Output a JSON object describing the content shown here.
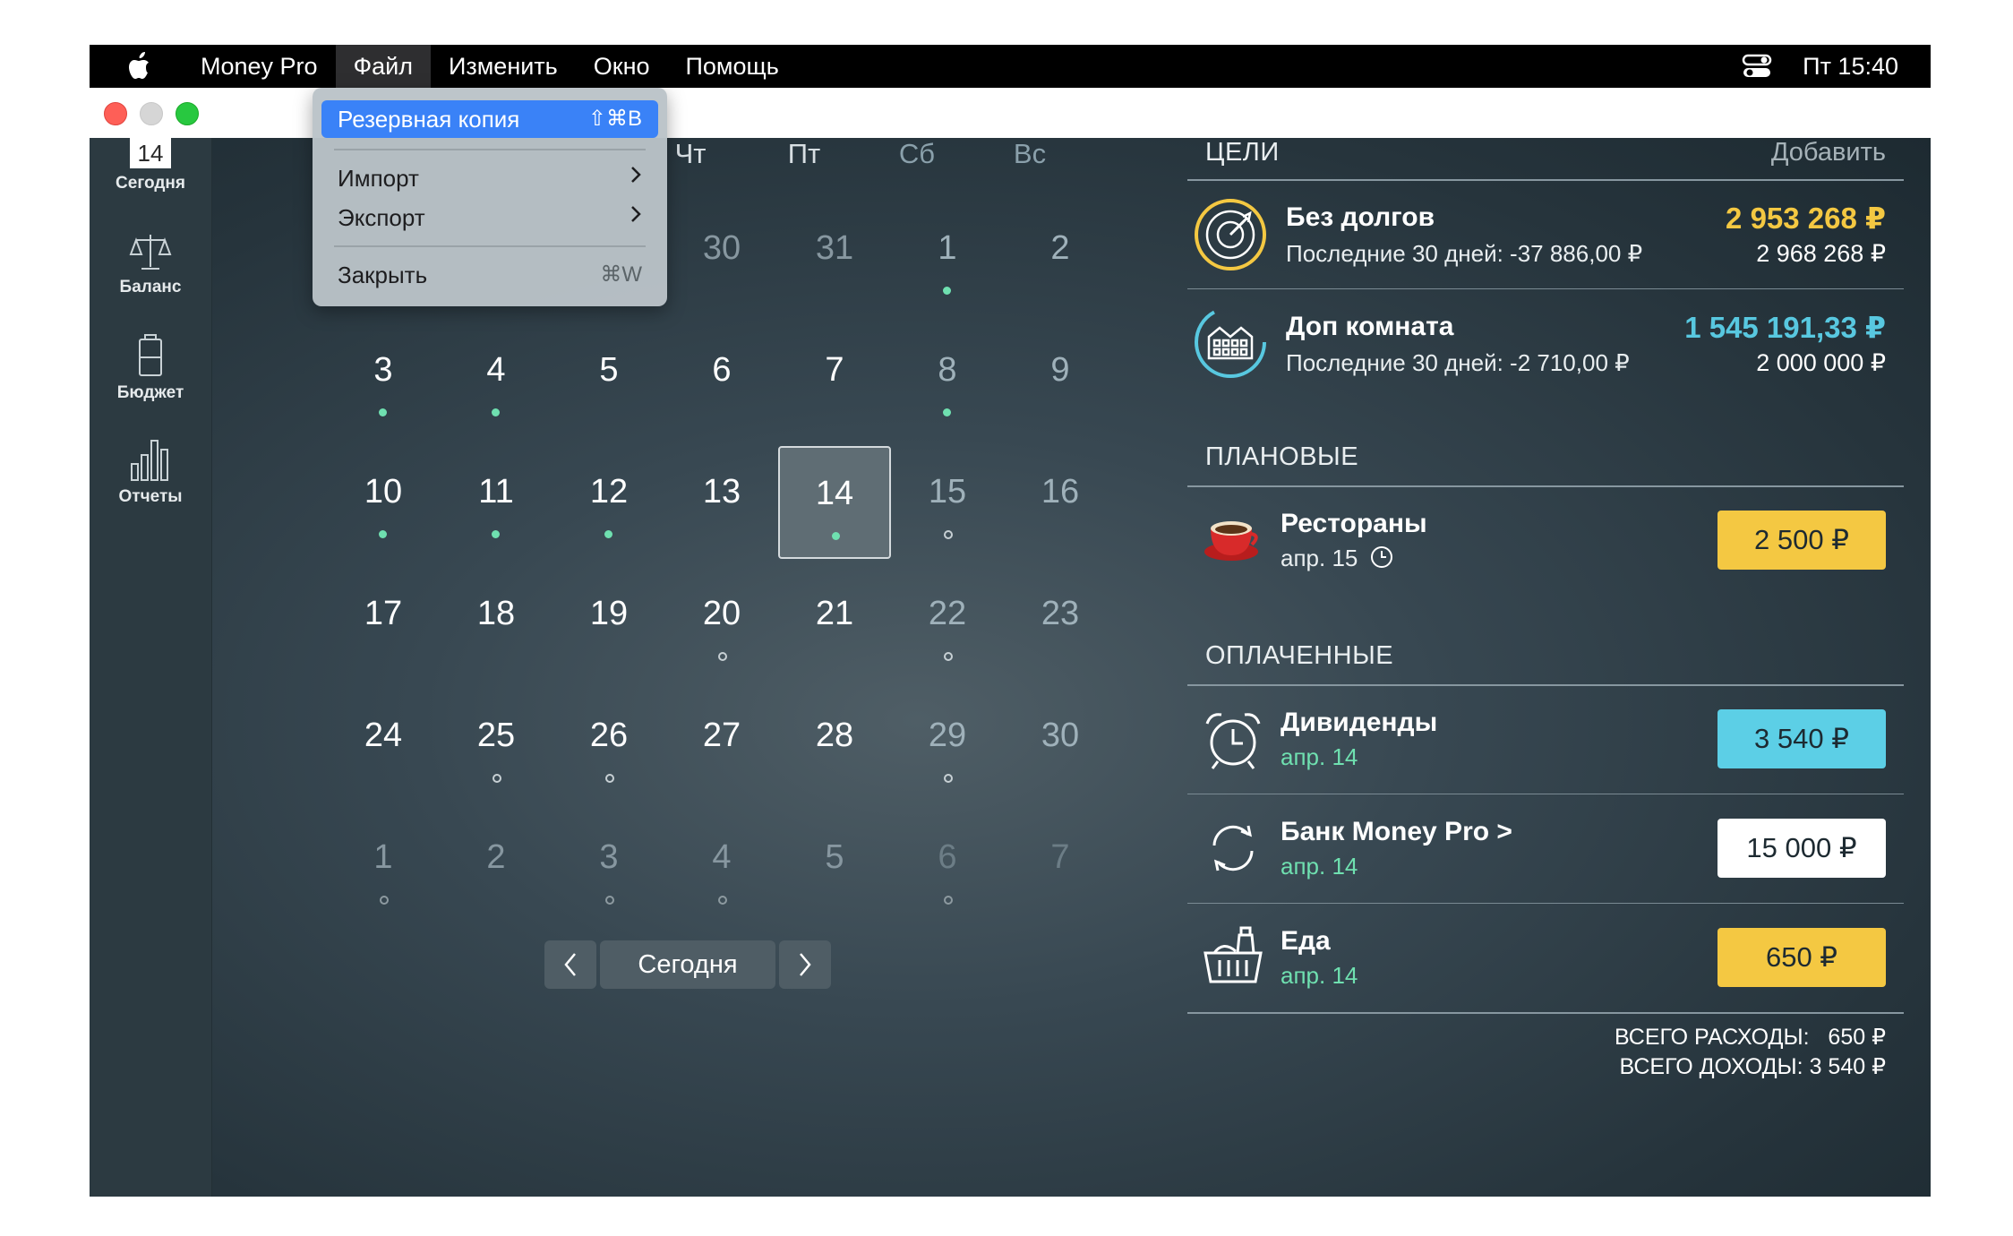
{
  "menubar": {
    "app_name": "Money Pro",
    "items": [
      "Файл",
      "Изменить",
      "Окно",
      "Помощь"
    ],
    "clock": "Пт 15:40"
  },
  "sidebar": {
    "today_date": "14",
    "items": [
      {
        "label": "Сегодня",
        "icon": "calendar-today-icon"
      },
      {
        "label": "Баланс",
        "icon": "scales-icon"
      },
      {
        "label": "Бюджет",
        "icon": "battery-icon"
      },
      {
        "label": "Отчеты",
        "icon": "bar-chart-icon"
      }
    ]
  },
  "calendar": {
    "weekdays_visible": [
      "Чт",
      "Пт",
      "Сб",
      "Вс"
    ],
    "weeks": [
      [
        {
          "d": "",
          "t": ""
        },
        {
          "d": "",
          "t": ""
        },
        {
          "d": "",
          "t": ""
        },
        {
          "d": "30",
          "t": "dim"
        },
        {
          "d": "31",
          "t": "dim"
        },
        {
          "d": "1",
          "t": "wk",
          "dot": "filled"
        },
        {
          "d": "2",
          "t": "wk"
        }
      ],
      [
        {
          "d": "3",
          "dot": "filled"
        },
        {
          "d": "4",
          "dot": "filled"
        },
        {
          "d": "5"
        },
        {
          "d": "6"
        },
        {
          "d": "7"
        },
        {
          "d": "8",
          "t": "wk",
          "dot": "filled"
        },
        {
          "d": "9",
          "t": "wk"
        }
      ],
      [
        {
          "d": "10",
          "dot": "filled"
        },
        {
          "d": "11",
          "dot": "filled"
        },
        {
          "d": "12",
          "dot": "filled"
        },
        {
          "d": "13"
        },
        {
          "d": "14",
          "today": true,
          "dot": "filled"
        },
        {
          "d": "15",
          "t": "wk",
          "dot": "hollow"
        },
        {
          "d": "16",
          "t": "wk"
        }
      ],
      [
        {
          "d": "17"
        },
        {
          "d": "18"
        },
        {
          "d": "19"
        },
        {
          "d": "20",
          "dot": "hollow"
        },
        {
          "d": "21"
        },
        {
          "d": "22",
          "t": "wk",
          "dot": "hollow"
        },
        {
          "d": "23",
          "t": "wk"
        }
      ],
      [
        {
          "d": "24"
        },
        {
          "d": "25",
          "dot": "hollow"
        },
        {
          "d": "26",
          "dot": "hollow"
        },
        {
          "d": "27"
        },
        {
          "d": "28"
        },
        {
          "d": "29",
          "t": "wk",
          "dot": "hollow"
        },
        {
          "d": "30",
          "t": "wk"
        }
      ],
      [
        {
          "d": "1",
          "t": "dim",
          "dot": "hollow"
        },
        {
          "d": "2",
          "t": "dim"
        },
        {
          "d": "3",
          "t": "dim",
          "dot": "hollow"
        },
        {
          "d": "4",
          "t": "dim",
          "dot": "hollow"
        },
        {
          "d": "5",
          "t": "dim"
        },
        {
          "d": "6",
          "t": "dimwk",
          "dot": "hollow"
        },
        {
          "d": "7",
          "t": "dimwk"
        }
      ]
    ],
    "today_button": "Сегодня"
  },
  "goals": {
    "header": "ЦЕЛИ",
    "add_label": "Добавить",
    "items": [
      {
        "title": "Без долгов",
        "subtitle": "Последние 30 дней: -37 886,00 ₽",
        "amount": "2 953 268 ₽",
        "target": "2 968 268 ₽",
        "color": "#f4c842"
      },
      {
        "title": "Доп комната",
        "subtitle": "Последние 30 дней: -2 710,00 ₽",
        "amount": "1 545 191,33 ₽",
        "target": "2 000 000 ₽",
        "color": "#58c8e0"
      }
    ]
  },
  "planned": {
    "header": "ПЛАНОВЫЕ",
    "items": [
      {
        "title": "Рестораны",
        "date": "апр. 15",
        "amount": "2 500 ₽",
        "color": "#f4c842"
      }
    ]
  },
  "paid": {
    "header": "ОПЛАЧЕННЫЕ",
    "items": [
      {
        "title": "Дивиденды",
        "date": "апр. 14",
        "amount": "3 540 ₽",
        "color": "#5ccfe6"
      },
      {
        "title": "Банк Money Pro >",
        "date": "апр. 14",
        "amount": "15 000 ₽",
        "color": "#ffffff"
      },
      {
        "title": "Еда",
        "date": "апр. 14",
        "amount": "650 ₽",
        "color": "#f4c842"
      }
    ]
  },
  "totals": {
    "expenses_label": "ВСЕГО РАСХОДЫ:",
    "expenses_value": "650 ₽",
    "income_label": "ВСЕГО ДОХОДЫ:",
    "income_value": "3 540 ₽"
  },
  "file_menu": {
    "backup": "Резервная копия",
    "backup_shortcut": "⇧⌘B",
    "import": "Импорт",
    "export": "Экспорт",
    "close": "Закрыть",
    "close_shortcut": "⌘W"
  }
}
